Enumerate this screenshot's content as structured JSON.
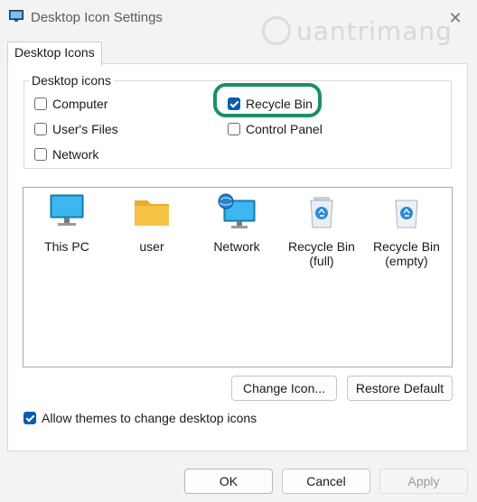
{
  "window": {
    "title": "Desktop Icon Settings",
    "close_symbol": "✕"
  },
  "watermark": {
    "text": "uantrimang"
  },
  "tabs": [
    {
      "label": "Desktop Icons"
    }
  ],
  "desktop_icons_group": {
    "legend": "Desktop icons",
    "checkboxes": [
      {
        "label": "Computer",
        "checked": false
      },
      {
        "label": "Recycle Bin",
        "checked": true
      },
      {
        "label": "User's Files",
        "checked": false
      },
      {
        "label": "Control Panel",
        "checked": false
      },
      {
        "label": "Network",
        "checked": false
      }
    ]
  },
  "icon_list": [
    {
      "label": "This PC",
      "icon": "monitor-icon"
    },
    {
      "label": "user",
      "icon": "folder-icon"
    },
    {
      "label": "Network",
      "icon": "network-icon"
    },
    {
      "label": "Recycle Bin\n(full)",
      "icon": "recycle-bin-full-icon"
    },
    {
      "label": "Recycle Bin\n(empty)",
      "icon": "recycle-bin-empty-icon"
    }
  ],
  "buttons": {
    "change_icon": "Change Icon...",
    "restore_default": "Restore Default",
    "ok": "OK",
    "cancel": "Cancel",
    "apply": "Apply"
  },
  "allow_themes": {
    "label": "Allow themes to change desktop icons",
    "checked": true
  },
  "colors": {
    "accent": "#0b5cad",
    "highlight_ring": "#1d8f63",
    "monitor": "#1e9fd8",
    "folder": "#f6c344"
  }
}
